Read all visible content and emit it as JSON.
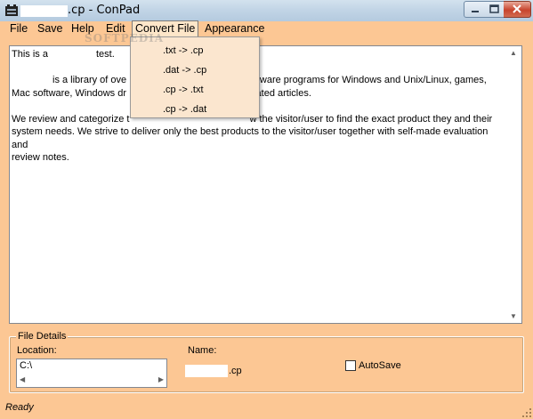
{
  "window": {
    "title": ".cp - ConPad",
    "controls": {
      "minimize_icon": "minimize-icon",
      "maximize_icon": "maximize-icon",
      "close_icon": "close-icon"
    }
  },
  "menu": {
    "file": "File",
    "save": "Save",
    "help": "Help",
    "edit": "Edit",
    "convert": "Convert File",
    "appearance": "Appearance"
  },
  "watermark": "SOFTPEDIA",
  "convert_menu": {
    "items": [
      ".txt -> .cp",
      ".dat -> .cp",
      ".cp -> .txt",
      ".cp -> .dat"
    ]
  },
  "editor": {
    "line1_pre": "This is a",
    "line1_post": "test.",
    "para2_a": "is a library of ove",
    "para2_b": "software programs for Windows and Unix/Linux, games,",
    "para2_c": "Mac software, Windows dr",
    "para2_d": "elated articles.",
    "para3_a": "We review and categorize t",
    "para3_b": "w the visitor/user to find the exact product they and their",
    "para3_c": "system needs. We strive to deliver only the best products to the visitor/user together with self-made evaluation and",
    "para3_d": "review notes."
  },
  "file_details": {
    "legend": "File Details",
    "location_label": "Location:",
    "location_value": "C:\\",
    "name_label": "Name:",
    "name_value": ".cp",
    "autosave_label": "AutoSave",
    "autosave_checked": false
  },
  "status": "Ready",
  "colors": {
    "background": "#fcc794",
    "menu_dropdown": "#fbe6cf",
    "titlebar": "#c2d5e6",
    "close_button": "#c7442d"
  }
}
